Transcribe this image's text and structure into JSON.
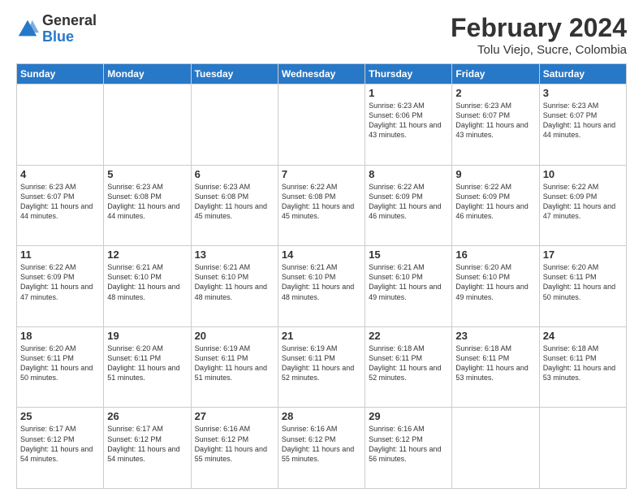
{
  "header": {
    "logo_general": "General",
    "logo_blue": "Blue",
    "month_year": "February 2024",
    "location": "Tolu Viejo, Sucre, Colombia"
  },
  "weekdays": [
    "Sunday",
    "Monday",
    "Tuesday",
    "Wednesday",
    "Thursday",
    "Friday",
    "Saturday"
  ],
  "weeks": [
    [
      {
        "day": "",
        "info": ""
      },
      {
        "day": "",
        "info": ""
      },
      {
        "day": "",
        "info": ""
      },
      {
        "day": "",
        "info": ""
      },
      {
        "day": "1",
        "info": "Sunrise: 6:23 AM\nSunset: 6:06 PM\nDaylight: 11 hours\nand 43 minutes."
      },
      {
        "day": "2",
        "info": "Sunrise: 6:23 AM\nSunset: 6:07 PM\nDaylight: 11 hours\nand 43 minutes."
      },
      {
        "day": "3",
        "info": "Sunrise: 6:23 AM\nSunset: 6:07 PM\nDaylight: 11 hours\nand 44 minutes."
      }
    ],
    [
      {
        "day": "4",
        "info": "Sunrise: 6:23 AM\nSunset: 6:07 PM\nDaylight: 11 hours\nand 44 minutes."
      },
      {
        "day": "5",
        "info": "Sunrise: 6:23 AM\nSunset: 6:08 PM\nDaylight: 11 hours\nand 44 minutes."
      },
      {
        "day": "6",
        "info": "Sunrise: 6:23 AM\nSunset: 6:08 PM\nDaylight: 11 hours\nand 45 minutes."
      },
      {
        "day": "7",
        "info": "Sunrise: 6:22 AM\nSunset: 6:08 PM\nDaylight: 11 hours\nand 45 minutes."
      },
      {
        "day": "8",
        "info": "Sunrise: 6:22 AM\nSunset: 6:09 PM\nDaylight: 11 hours\nand 46 minutes."
      },
      {
        "day": "9",
        "info": "Sunrise: 6:22 AM\nSunset: 6:09 PM\nDaylight: 11 hours\nand 46 minutes."
      },
      {
        "day": "10",
        "info": "Sunrise: 6:22 AM\nSunset: 6:09 PM\nDaylight: 11 hours\nand 47 minutes."
      }
    ],
    [
      {
        "day": "11",
        "info": "Sunrise: 6:22 AM\nSunset: 6:09 PM\nDaylight: 11 hours\nand 47 minutes."
      },
      {
        "day": "12",
        "info": "Sunrise: 6:21 AM\nSunset: 6:10 PM\nDaylight: 11 hours\nand 48 minutes."
      },
      {
        "day": "13",
        "info": "Sunrise: 6:21 AM\nSunset: 6:10 PM\nDaylight: 11 hours\nand 48 minutes."
      },
      {
        "day": "14",
        "info": "Sunrise: 6:21 AM\nSunset: 6:10 PM\nDaylight: 11 hours\nand 48 minutes."
      },
      {
        "day": "15",
        "info": "Sunrise: 6:21 AM\nSunset: 6:10 PM\nDaylight: 11 hours\nand 49 minutes."
      },
      {
        "day": "16",
        "info": "Sunrise: 6:20 AM\nSunset: 6:10 PM\nDaylight: 11 hours\nand 49 minutes."
      },
      {
        "day": "17",
        "info": "Sunrise: 6:20 AM\nSunset: 6:11 PM\nDaylight: 11 hours\nand 50 minutes."
      }
    ],
    [
      {
        "day": "18",
        "info": "Sunrise: 6:20 AM\nSunset: 6:11 PM\nDaylight: 11 hours\nand 50 minutes."
      },
      {
        "day": "19",
        "info": "Sunrise: 6:20 AM\nSunset: 6:11 PM\nDaylight: 11 hours\nand 51 minutes."
      },
      {
        "day": "20",
        "info": "Sunrise: 6:19 AM\nSunset: 6:11 PM\nDaylight: 11 hours\nand 51 minutes."
      },
      {
        "day": "21",
        "info": "Sunrise: 6:19 AM\nSunset: 6:11 PM\nDaylight: 11 hours\nand 52 minutes."
      },
      {
        "day": "22",
        "info": "Sunrise: 6:18 AM\nSunset: 6:11 PM\nDaylight: 11 hours\nand 52 minutes."
      },
      {
        "day": "23",
        "info": "Sunrise: 6:18 AM\nSunset: 6:11 PM\nDaylight: 11 hours\nand 53 minutes."
      },
      {
        "day": "24",
        "info": "Sunrise: 6:18 AM\nSunset: 6:11 PM\nDaylight: 11 hours\nand 53 minutes."
      }
    ],
    [
      {
        "day": "25",
        "info": "Sunrise: 6:17 AM\nSunset: 6:12 PM\nDaylight: 11 hours\nand 54 minutes."
      },
      {
        "day": "26",
        "info": "Sunrise: 6:17 AM\nSunset: 6:12 PM\nDaylight: 11 hours\nand 54 minutes."
      },
      {
        "day": "27",
        "info": "Sunrise: 6:16 AM\nSunset: 6:12 PM\nDaylight: 11 hours\nand 55 minutes."
      },
      {
        "day": "28",
        "info": "Sunrise: 6:16 AM\nSunset: 6:12 PM\nDaylight: 11 hours\nand 55 minutes."
      },
      {
        "day": "29",
        "info": "Sunrise: 6:16 AM\nSunset: 6:12 PM\nDaylight: 11 hours\nand 56 minutes."
      },
      {
        "day": "",
        "info": ""
      },
      {
        "day": "",
        "info": ""
      }
    ]
  ]
}
